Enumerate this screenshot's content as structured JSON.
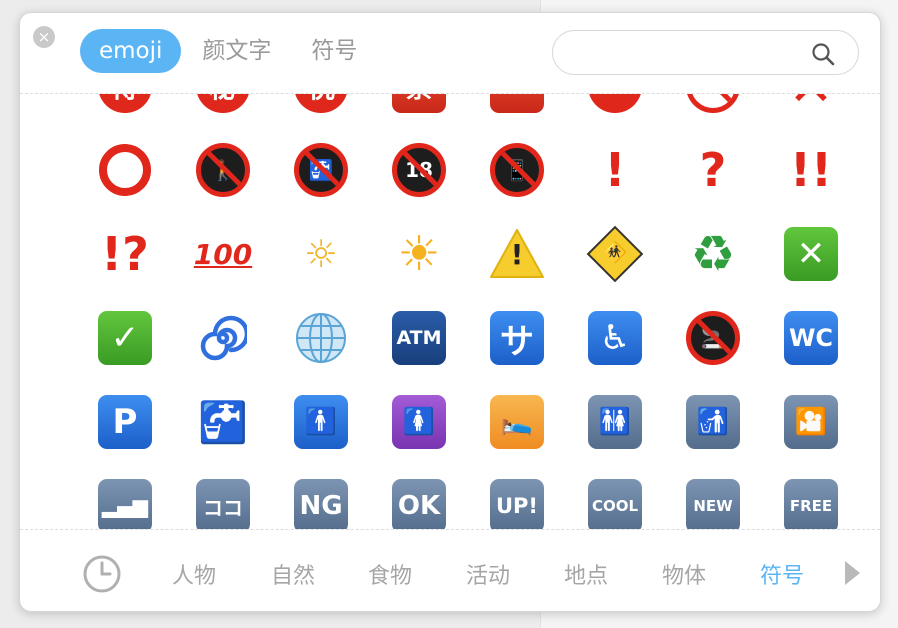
{
  "header": {
    "close_glyph": "×",
    "tabs": [
      {
        "label": "emoji",
        "active": true
      },
      {
        "label": "颜文字",
        "active": false
      },
      {
        "label": "符号",
        "active": false
      }
    ],
    "search": {
      "value": "",
      "placeholder": ""
    }
  },
  "emoji_rows": [
    [
      {
        "name": "secret-ideograph-icon",
        "text": "得"
      },
      {
        "name": "secret-ideograph-icon",
        "text": "秘"
      },
      {
        "name": "congratulations-ideograph-icon",
        "text": "祝"
      },
      {
        "name": "vacancy-ideograph-icon",
        "text": "票"
      },
      {
        "name": "sos-icon",
        "text": "SOS"
      },
      {
        "name": "no-entry-icon",
        "text": ""
      },
      {
        "name": "prohibited-icon",
        "text": ""
      },
      {
        "name": "cross-mark-icon",
        "text": "✕"
      }
    ],
    [
      {
        "name": "hollow-red-circle-icon",
        "text": ""
      },
      {
        "name": "no-pedestrians-icon",
        "text": "🚶"
      },
      {
        "name": "non-potable-water-icon",
        "text": "🚰"
      },
      {
        "name": "no-one-under-eighteen-icon",
        "text": "18"
      },
      {
        "name": "no-mobile-phones-icon",
        "text": "📱"
      },
      {
        "name": "exclamation-mark-icon",
        "text": "!"
      },
      {
        "name": "question-mark-icon",
        "text": "?"
      },
      {
        "name": "double-exclamation-icon",
        "text": "!!"
      }
    ],
    [
      {
        "name": "exclamation-question-icon",
        "text": "!?"
      },
      {
        "name": "hundred-points-icon",
        "text": "100"
      },
      {
        "name": "dim-button-icon",
        "text": "☼"
      },
      {
        "name": "bright-button-icon",
        "text": "☀"
      },
      {
        "name": "warning-icon",
        "text": "!"
      },
      {
        "name": "children-crossing-icon",
        "text": "🚸"
      },
      {
        "name": "recycling-icon",
        "text": "♻"
      },
      {
        "name": "cross-mark-button-icon",
        "text": "✕"
      }
    ],
    [
      {
        "name": "check-mark-button-icon",
        "text": "✓"
      },
      {
        "name": "cyclone-icon",
        "text": "🌀"
      },
      {
        "name": "globe-meridians-icon",
        "text": "🌐"
      },
      {
        "name": "atm-sign-icon",
        "text": "ATM"
      },
      {
        "name": "service-charge-icon",
        "text": "サ"
      },
      {
        "name": "wheelchair-icon",
        "text": "♿"
      },
      {
        "name": "no-smoking-icon",
        "text": "🚬"
      },
      {
        "name": "water-closet-icon",
        "text": "WC"
      }
    ],
    [
      {
        "name": "p-button-icon",
        "text": "P"
      },
      {
        "name": "potable-water-icon",
        "text": "🚰"
      },
      {
        "name": "mens-room-icon",
        "text": "🚹"
      },
      {
        "name": "womens-room-icon",
        "text": "🚺"
      },
      {
        "name": "baby-symbol-icon",
        "text": "🛌"
      },
      {
        "name": "restroom-icon",
        "text": "🚻"
      },
      {
        "name": "litter-in-bin-icon",
        "text": "🚮"
      },
      {
        "name": "cinema-icon",
        "text": "🎦"
      }
    ],
    [
      {
        "name": "antenna-bars-icon",
        "text": "▂▄▆"
      },
      {
        "name": "here-button-icon",
        "text": "ココ"
      },
      {
        "name": "ng-button-icon",
        "text": "NG"
      },
      {
        "name": "ok-button-icon",
        "text": "OK"
      },
      {
        "name": "up-button-icon",
        "text": "UP!"
      },
      {
        "name": "cool-button-icon",
        "text": "COOL"
      },
      {
        "name": "new-button-icon",
        "text": "NEW"
      },
      {
        "name": "free-button-icon",
        "text": "FREE"
      }
    ]
  ],
  "categories": [
    {
      "label": "人物",
      "active": false
    },
    {
      "label": "自然",
      "active": false
    },
    {
      "label": "食物",
      "active": false
    },
    {
      "label": "活动",
      "active": false
    },
    {
      "label": "地点",
      "active": false
    },
    {
      "label": "物体",
      "active": false
    },
    {
      "label": "符号",
      "active": true
    }
  ],
  "colors": {
    "accent": "#5bb5f5",
    "muted": "#a6a6a6"
  }
}
